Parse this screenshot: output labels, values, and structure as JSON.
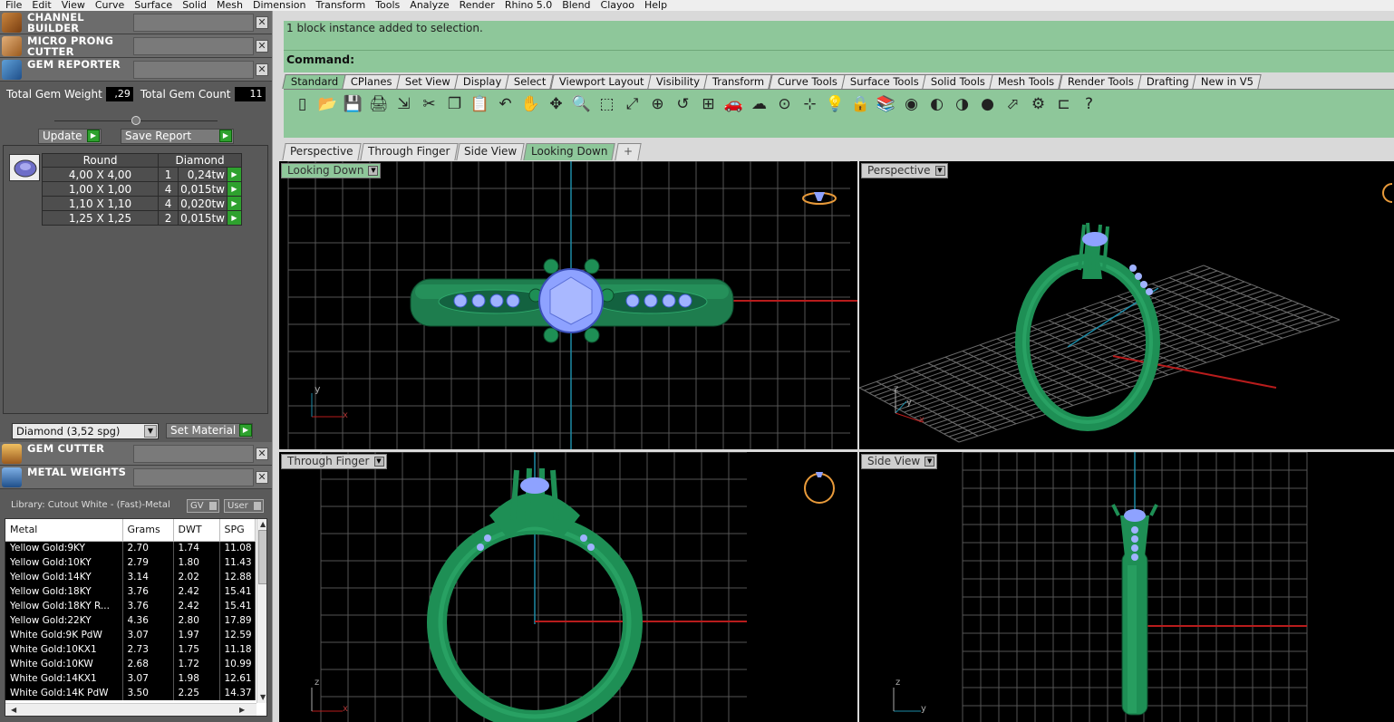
{
  "menu": [
    "File",
    "Edit",
    "View",
    "Curve",
    "Surface",
    "Solid",
    "Mesh",
    "Dimension",
    "Transform",
    "Tools",
    "Analyze",
    "Render",
    "Rhino 5.0",
    "Blend",
    "Clayoo",
    "Help"
  ],
  "plugins": {
    "channel_builder": "CHANNEL BUILDER",
    "micro_prong_cutter": "MICRO PRONG CUTTER",
    "gem_reporter": "GEM REPORTER",
    "gem_cutter": "GEM CUTTER",
    "metal_weights": "METAL WEIGHTS",
    "close_glyph": "✕"
  },
  "gem_report": {
    "total_weight_label": "Total Gem Weight",
    "total_weight": ",29",
    "total_count_label": "Total Gem Count",
    "total_count": "11",
    "update_label": "Update",
    "save_report_label": "Save Report",
    "headers": [
      "Round",
      "Diamond"
    ],
    "rows": [
      {
        "size": "4,00 X 4,00",
        "qty": "1",
        "weight": "0,24tw"
      },
      {
        "size": "1,00 X 1,00",
        "qty": "4",
        "weight": "0,015tw"
      },
      {
        "size": "1,10 X 1,10",
        "qty": "4",
        "weight": "0,020tw"
      },
      {
        "size": "1,25 X 1,25",
        "qty": "2",
        "weight": "0,015tw"
      }
    ],
    "material_select": "Diamond     (3,52 spg)",
    "set_material_label": "Set Material"
  },
  "metal_weights": {
    "library": "Library: Cutout White - (Fast)-Metal",
    "gv_label": "GV",
    "user_label": "User",
    "headers": [
      "Metal",
      "Grams",
      "DWT",
      "SPG"
    ],
    "rows": [
      [
        "Yellow Gold:9KY",
        "2.70",
        "1.74",
        "11.08"
      ],
      [
        "Yellow Gold:10KY",
        "2.79",
        "1.80",
        "11.43"
      ],
      [
        "Yellow Gold:14KY",
        "3.14",
        "2.02",
        "12.88"
      ],
      [
        "Yellow Gold:18KY",
        "3.76",
        "2.42",
        "15.41"
      ],
      [
        "Yellow Gold:18KY R...",
        "3.76",
        "2.42",
        "15.41"
      ],
      [
        "Yellow Gold:22KY",
        "4.36",
        "2.80",
        "17.89"
      ],
      [
        "White Gold:9K PdW",
        "3.07",
        "1.97",
        "12.59"
      ],
      [
        "White Gold:10KX1",
        "2.73",
        "1.75",
        "11.18"
      ],
      [
        "White Gold:10KW",
        "2.68",
        "1.72",
        "10.99"
      ],
      [
        "White Gold:14KX1",
        "3.07",
        "1.98",
        "12.61"
      ],
      [
        "White Gold:14K PdW",
        "3.50",
        "2.25",
        "14.37"
      ]
    ]
  },
  "command": {
    "history": "1 block instance added to selection.",
    "prompt": "Command:"
  },
  "toolbar_tabs": [
    "Standard",
    "CPlanes",
    "Set View",
    "Display",
    "Select",
    "Viewport Layout",
    "Visibility",
    "Transform",
    "Curve Tools",
    "Surface Tools",
    "Solid Tools",
    "Mesh Tools",
    "Render Tools",
    "Drafting",
    "New in V5"
  ],
  "toolbar_icons": [
    "new-file-icon",
    "open-icon",
    "save-icon",
    "print-icon",
    "import-icon",
    "cut-icon",
    "copy-icon",
    "paste-icon",
    "undo-icon",
    "pan-icon",
    "rotate-view-icon",
    "zoom-icon",
    "zoom-window-icon",
    "zoom-extents-icon",
    "zoom-selected-icon",
    "undo-view-icon",
    "four-viewports-icon",
    "car-icon",
    "fog-icon",
    "cplane-icon",
    "grid-snap-icon",
    "light-icon",
    "lock-icon",
    "layer-icon",
    "color-wheel-icon",
    "shade-icon",
    "render-icon",
    "material-icon",
    "select-icon",
    "settings-icon",
    "dimensions-icon",
    "help-icon"
  ],
  "toolbar_glyphs": [
    "▯",
    "📂",
    "💾",
    "🖨",
    "⇲",
    "✂",
    "❐",
    "📋",
    "↶",
    "✋",
    "✥",
    "🔍",
    "⬚",
    "⤢",
    "⊕",
    "↺",
    "⊞",
    "🚗",
    "☁",
    "⊙",
    "⊹",
    "💡",
    "🔒",
    "📚",
    "◉",
    "◐",
    "◑",
    "●",
    "⬀",
    "⚙",
    "⊏",
    "?"
  ],
  "view_tabs": [
    "Perspective",
    "Through Finger",
    "Side View",
    "Looking Down"
  ],
  "add_tab": "+",
  "viewports": {
    "top_left": "Looking Down",
    "top_right": "Perspective",
    "bottom_left": "Through Finger",
    "bottom_right": "Side View"
  },
  "axes": {
    "x": "x",
    "y": "y",
    "z": "z"
  },
  "colors": {
    "accent_green": "#8ec79a",
    "ring_green": "#1f8f5a",
    "gem_blue": "#8aa8ff"
  }
}
